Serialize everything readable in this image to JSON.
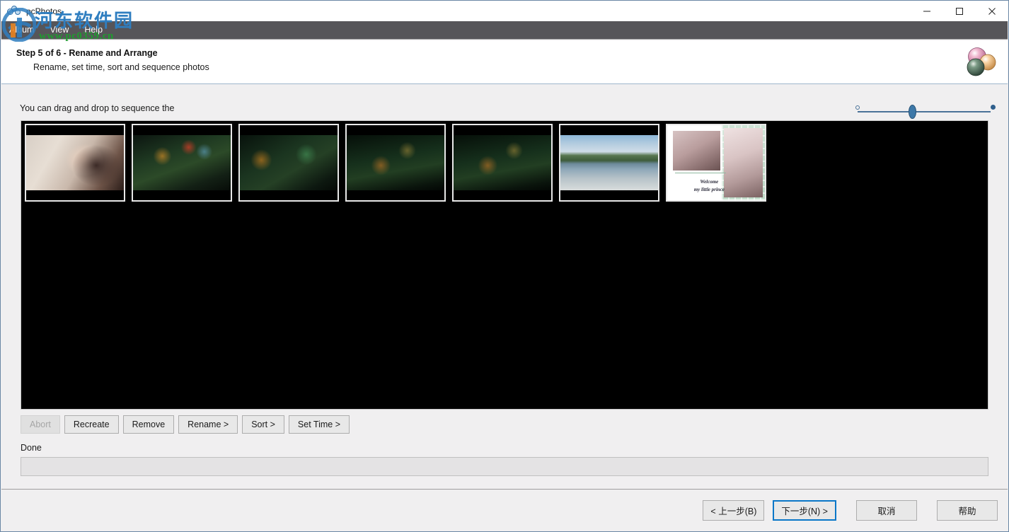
{
  "window": {
    "title": "pcPhotos",
    "icon": "photos-circles-icon",
    "controls": {
      "minimize": "minimize-icon",
      "maximize": "maximize-icon",
      "close": "close-icon"
    }
  },
  "menubar": {
    "items": [
      {
        "label": "Album"
      },
      {
        "label": "View"
      },
      {
        "label": "Help"
      }
    ]
  },
  "header": {
    "step_title": "Step 5 of 6 - Rename and Arrange",
    "step_subtitle": "Rename, set time, sort and sequence photos",
    "logo": "three-spheres-logo"
  },
  "main": {
    "hint": "You can drag and drop to sequence the",
    "zoom_slider": {
      "name": "thumbnail-size-slider",
      "min_icon": "small-thumbnail-icon",
      "max_icon": "large-thumbnail-icon",
      "value": "42"
    },
    "thumbnails": [
      {
        "name": "thumbnail-1",
        "art": "art-girl",
        "selected": true
      },
      {
        "name": "thumbnail-2",
        "art": "art-game",
        "selected": false
      },
      {
        "name": "thumbnail-3",
        "art": "art-game2",
        "selected": false
      },
      {
        "name": "thumbnail-4",
        "art": "art-game3",
        "selected": false
      },
      {
        "name": "thumbnail-5",
        "art": "art-game3",
        "selected": false
      },
      {
        "name": "thumbnail-6",
        "art": "art-lake",
        "selected": false
      },
      {
        "name": "thumbnail-7",
        "art": "art-pink",
        "selected": false
      }
    ],
    "pink_caption_line1": "Welcome",
    "pink_caption_line2": "my little prince"
  },
  "actions": {
    "abort": "Abort",
    "recreate": "Recreate",
    "remove": "Remove",
    "rename": "Rename  >",
    "sort": "Sort  >",
    "set_time": "Set Time  >"
  },
  "status": {
    "label": "Done",
    "progress_value": ""
  },
  "footer": {
    "back": "< 上一步(B)",
    "next": "下一步(N) >",
    "cancel": "取消",
    "help": "帮助"
  },
  "watermark": {
    "chinese": "河东软件园",
    "url": "www.pc0359.cn"
  },
  "colors": {
    "menubar_bg": "#565559",
    "header_bg": "#ffffff",
    "body_bg": "#f0eff0",
    "canvas_bg": "#000000",
    "accent_focus": "#0a77c8",
    "slider": "#3d78a8",
    "watermark_blue": "#2f7ec0",
    "watermark_green": "#1f9d2f"
  }
}
